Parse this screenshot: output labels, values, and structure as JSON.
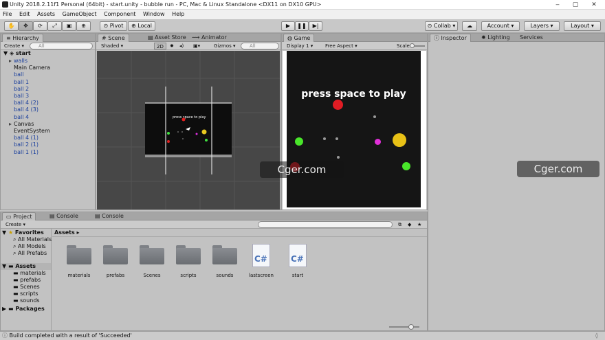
{
  "window": {
    "title": "Unity 2018.2.11f1 Personal (64bit) - start.unity - bubble run - PC, Mac & Linux Standalone <DX11 on DX10 GPU>",
    "controls": [
      "‒",
      "▢",
      "✕"
    ]
  },
  "menu": [
    "File",
    "Edit",
    "Assets",
    "GameObject",
    "Component",
    "Window",
    "Help"
  ],
  "toolbar": {
    "pivot": "Pivot",
    "local": "Local",
    "collab": "Collab ▾",
    "account": "Account",
    "layers": "Layers",
    "layout": "Layout"
  },
  "hierarchy": {
    "tab": "Hierarchy",
    "create": "Create",
    "search": "All",
    "scene": "start",
    "items": [
      {
        "label": "walls",
        "color": "blue",
        "expand": true
      },
      {
        "label": "Main Camera",
        "color": "black"
      },
      {
        "label": "ball",
        "color": "blue"
      },
      {
        "label": "ball 1",
        "color": "blue"
      },
      {
        "label": "ball 2",
        "color": "blue"
      },
      {
        "label": "ball 3",
        "color": "blue"
      },
      {
        "label": "ball 4 (2)",
        "color": "blue"
      },
      {
        "label": "ball 4 (3)",
        "color": "blue"
      },
      {
        "label": "ball 4",
        "color": "blue"
      },
      {
        "label": "Canvas",
        "color": "black",
        "expand": true
      },
      {
        "label": "EventSystem",
        "color": "black"
      },
      {
        "label": "ball 4 (1)",
        "color": "blue"
      },
      {
        "label": "ball 2 (1)",
        "color": "blue"
      },
      {
        "label": "ball 1 (1)",
        "color": "blue"
      }
    ]
  },
  "scene": {
    "tabs": [
      "Scene",
      "Asset Store",
      "Animator"
    ],
    "shaded": "Shaded",
    "mode2d": "2D",
    "gizmos": "Gizmos",
    "search": "All",
    "preview_text": "press space to play"
  },
  "game": {
    "tab": "Game",
    "display": "Display 1",
    "aspect": "Free Aspect",
    "scale": "Scale",
    "text": "press space to play"
  },
  "inspector": {
    "tabs": [
      "Inspector",
      "Lighting",
      "Services"
    ]
  },
  "bottom": {
    "tabs": [
      "Project",
      "Console",
      "Console"
    ],
    "create": "Create",
    "favorites_label": "Favorites",
    "favorites": [
      "All Materials",
      "All Models",
      "All Prefabs"
    ],
    "assets_label": "Assets",
    "asset_folders": [
      "materials",
      "prefabs",
      "Scenes",
      "scripts",
      "sounds"
    ],
    "packages_label": "Packages",
    "breadcrumb": "Assets",
    "assets": [
      {
        "label": "materials",
        "kind": "folder"
      },
      {
        "label": "prefabs",
        "kind": "folder"
      },
      {
        "label": "Scenes",
        "kind": "folder"
      },
      {
        "label": "scripts",
        "kind": "folder"
      },
      {
        "label": "sounds",
        "kind": "folder"
      },
      {
        "label": "lastscreen",
        "kind": "cs"
      },
      {
        "label": "start",
        "kind": "cs"
      }
    ],
    "cs_glyph": "C#"
  },
  "status": "Build completed with a result of 'Succeeded'",
  "watermark": "Cger.com"
}
